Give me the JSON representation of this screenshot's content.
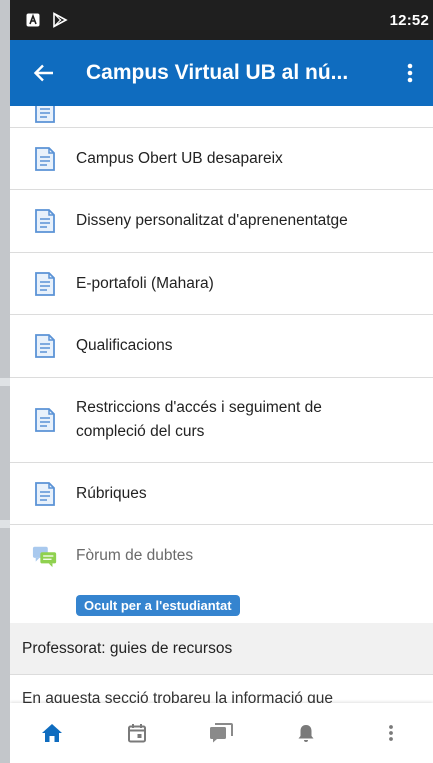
{
  "status_bar": {
    "time": "12:52",
    "icons": [
      "notification-a-icon",
      "play-store-icon"
    ]
  },
  "app_bar": {
    "title": "Campus Virtual UB al nú...",
    "back_icon": "arrow-left-icon",
    "menu_icon": "more-vert-icon"
  },
  "activities": [
    {
      "label": "Campus Obert UB desapareix",
      "icon": "file-page-icon"
    },
    {
      "label": "Disseny personalitzat d'aprenenentatge",
      "icon": "file-page-icon"
    },
    {
      "label": "E-portafoli (Mahara)",
      "icon": "file-page-icon"
    },
    {
      "label": "Qualificacions",
      "icon": "file-page-icon"
    },
    {
      "label": "Restriccions d'accés i seguiment de compleció del curs",
      "icon": "file-page-icon"
    },
    {
      "label": "Rúbriques",
      "icon": "file-page-icon"
    }
  ],
  "forum": {
    "label": "Fòrum de dubtes",
    "icon": "forum-icon",
    "badge": "Ocult per a l'estudiantat"
  },
  "section": {
    "title": "Professorat: guies de recursos",
    "summary": "En aquesta secció trobareu la informació que"
  },
  "bottom_nav": [
    {
      "name": "home",
      "icon": "home-icon",
      "active": true
    },
    {
      "name": "calendar",
      "icon": "calendar-icon",
      "active": false
    },
    {
      "name": "messages",
      "icon": "messages-icon",
      "active": false
    },
    {
      "name": "notifications",
      "icon": "bell-icon",
      "active": false
    },
    {
      "name": "more",
      "icon": "more-vert-icon",
      "active": false
    }
  ],
  "colors": {
    "app_bar": "#0f6cbf",
    "status_bar": "#1f1f1f",
    "badge": "#3584cf",
    "nav_active": "#0f6cbf",
    "nav_inactive": "#7a7a7a"
  }
}
